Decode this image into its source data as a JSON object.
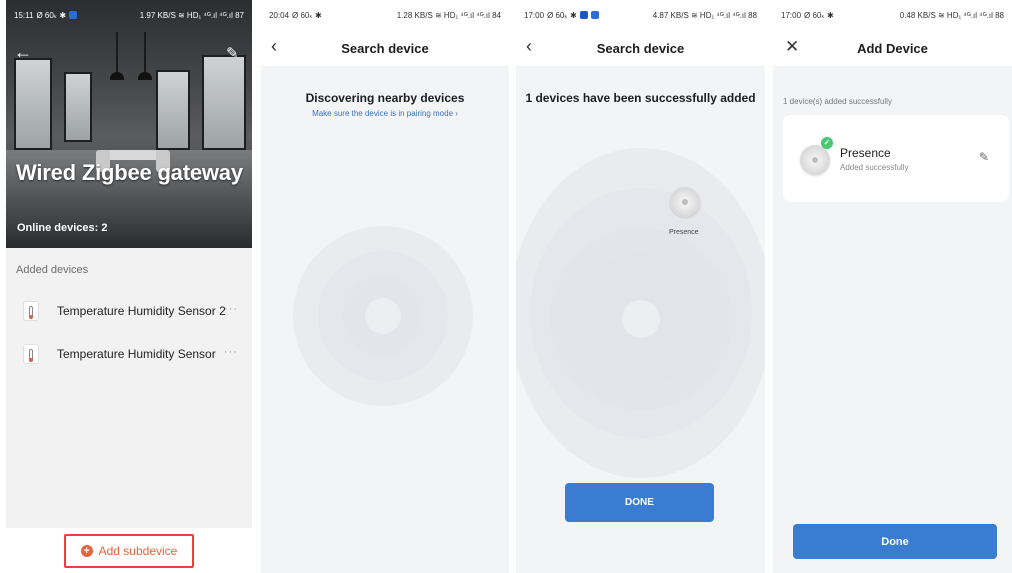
{
  "panel1": {
    "status": {
      "time": "15:11",
      "left_extra": "Ø 60ₖ ✱",
      "right": "1.97 KB/S ≋ HD₁ ⁴ᴳ.ıl ⁴ᴳ.ıl 87"
    },
    "hero_title": "Wired Zigbee gateway",
    "online": "Online devices: 2",
    "section_label": "Added devices",
    "devices": [
      {
        "name": "Temperature Humidity Sensor 2",
        "more": "···"
      },
      {
        "name": "Temperature Humidity Sensor",
        "more": "···"
      }
    ],
    "add_subdevice": "Add subdevice",
    "back_icon": "←",
    "edit_icon": "✎"
  },
  "panel2": {
    "status": {
      "time": "20:04",
      "left_extra": "Ø 60ₖ ✱",
      "right": "1.28 KB/S ≋ HD₁ ⁴ᴳ.ıl ⁴ᴳ.ıl 84"
    },
    "title": "Search device",
    "back_icon": "‹",
    "heading": "Discovering nearby devices",
    "subtext": "Make sure the device is in pairing mode ›"
  },
  "panel3": {
    "status": {
      "time": "17:00",
      "left_extra": "Ø 60ₖ ✱",
      "right": "4.87 KB/S ≋ HD₁ ⁴ᴳ.ıl ⁴ᴳ.ıl 88"
    },
    "title": "Search device",
    "back_icon": "‹",
    "heading": "1 devices have been successfully added",
    "device_label": "Presence",
    "done": "DONE"
  },
  "panel4": {
    "status": {
      "time": "17:00",
      "left_extra": "Ø 60ₖ ✱",
      "right": "0.48 KB/S ≋ HD₁ ⁴ᴳ.ıl ⁴ᴳ.ıl 88"
    },
    "title": "Add Device",
    "close_icon": "✕",
    "note": "1 device(s) added successfully",
    "device_name": "Presence",
    "device_status": "Added successfully",
    "edit_icon": "✎",
    "done": "Done"
  },
  "colors": {
    "accent": "#3a7cd0",
    "orange": "#e8623a",
    "red_border": "#e0443a",
    "success": "#48c774"
  }
}
